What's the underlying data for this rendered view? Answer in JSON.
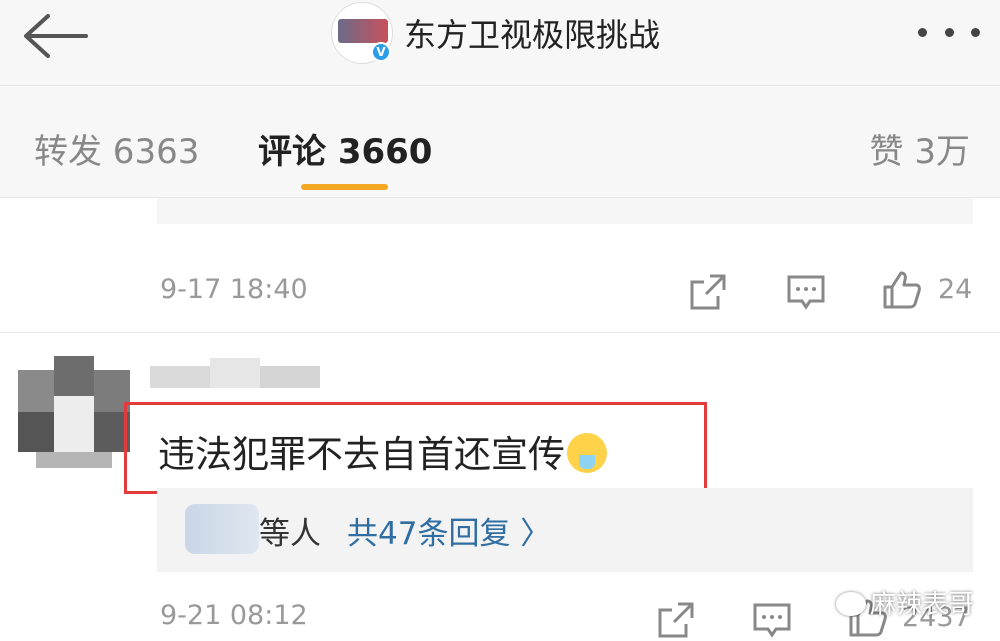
{
  "header": {
    "title": "东方卫视极限挑战",
    "verified_badge": "V",
    "icons": [
      "back-arrow-icon",
      "more-dots-icon"
    ]
  },
  "tabs": [
    {
      "label": "转发 6363"
    },
    {
      "label": "评论 3660"
    },
    {
      "label": "赞 3万"
    }
  ],
  "colors": {
    "accent": "#f5a623",
    "link": "#2f6da3",
    "highlight_border": "#e33b3b",
    "verified": "#2a9ee8"
  },
  "comments": [
    {
      "time": "9-17 18:40",
      "likes": "24"
    },
    {
      "text": "违法犯罪不去自首还宣传",
      "reply_suffix": "等人",
      "reply_link": "共47条回复 〉",
      "time": "9-21 08:12",
      "likes": "2437"
    }
  ],
  "watermark": "麻辣表哥"
}
